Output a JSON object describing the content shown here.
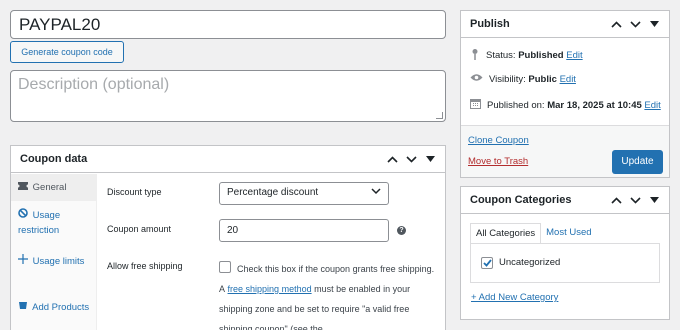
{
  "coupon": {
    "code": "PAYPAL20",
    "generate_label": "Generate coupon code",
    "description_placeholder": "Description (optional)"
  },
  "coupon_data": {
    "title": "Coupon data",
    "tabs": [
      {
        "label": "General",
        "icon": "ticket-icon"
      },
      {
        "label": "Usage restriction",
        "icon": "block-icon"
      },
      {
        "label": "Usage limits",
        "icon": "arrows-icon"
      },
      {
        "label": "Add Products",
        "icon": "plus-icon"
      }
    ],
    "discount_type_label": "Discount type",
    "discount_type_value": "Percentage discount",
    "amount_label": "Coupon amount",
    "amount_value": "20",
    "free_shipping_label": "Allow free shipping",
    "free_shipping_text_1": "Check this box if the coupon grants free shipping. A",
    "free_shipping_link": "free shipping method",
    "free_shipping_text_2": "must be enabled in your shipping zone and be set to require \"a valid free shipping coupon\" (see the",
    "free_shipping_checked": false
  },
  "publish": {
    "title": "Publish",
    "status_label": "Status:",
    "status_value": "Published",
    "visibility_label": "Visibility:",
    "visibility_value": "Public",
    "published_label": "Published on:",
    "published_value": "Mar 18, 2025 at 10:45",
    "edit_label": "Edit",
    "clone_label": "Clone Coupon",
    "trash_label": "Move to Trash",
    "update_label": "Update"
  },
  "categories": {
    "title": "Coupon Categories",
    "tab_all": "All Categories",
    "tab_used": "Most Used",
    "items": [
      {
        "label": "Uncategorized",
        "checked": true
      }
    ],
    "add_label": "+ Add New Category"
  },
  "colors": {
    "accent": "#2271b1",
    "danger": "#b32d2e",
    "background": "#f0f0f1"
  }
}
